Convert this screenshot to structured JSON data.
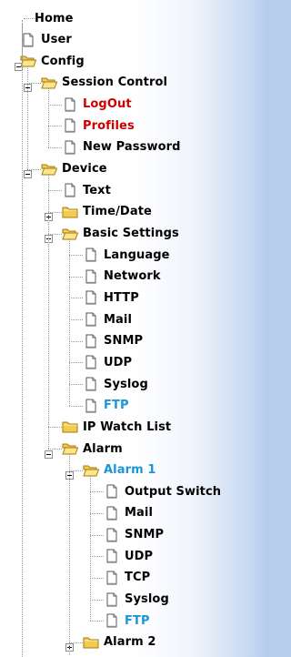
{
  "tree": [
    {
      "id": "home",
      "label": "Home",
      "depth": 0,
      "icon": "none",
      "toggle": "none",
      "color": "default"
    },
    {
      "id": "user",
      "label": "User",
      "depth": 1,
      "icon": "page-icon",
      "toggle": "none",
      "color": "default"
    },
    {
      "id": "config",
      "label": "Config",
      "depth": 1,
      "icon": "folder-open-icon",
      "toggle": "minus",
      "color": "default"
    },
    {
      "id": "session-control",
      "label": "Session Control",
      "depth": 2,
      "icon": "folder-open-icon",
      "toggle": "minus",
      "color": "default"
    },
    {
      "id": "logout",
      "label": "LogOut",
      "depth": 3,
      "icon": "page-icon",
      "toggle": "none",
      "color": "#cc0000"
    },
    {
      "id": "profiles",
      "label": "Profiles",
      "depth": 3,
      "icon": "page-icon",
      "toggle": "none",
      "color": "#cc0000"
    },
    {
      "id": "new-password",
      "label": "New Password",
      "depth": 3,
      "icon": "page-icon",
      "toggle": "none",
      "color": "default"
    },
    {
      "id": "device",
      "label": "Device",
      "depth": 2,
      "icon": "folder-open-icon",
      "toggle": "minus",
      "color": "default"
    },
    {
      "id": "text",
      "label": "Text",
      "depth": 3,
      "icon": "page-icon",
      "toggle": "none",
      "color": "default"
    },
    {
      "id": "time-date",
      "label": "Time/Date",
      "depth": 3,
      "icon": "folder-closed-icon",
      "toggle": "plus",
      "color": "default"
    },
    {
      "id": "basic-settings",
      "label": "Basic Settings",
      "depth": 3,
      "icon": "folder-open-icon",
      "toggle": "minus",
      "color": "default"
    },
    {
      "id": "language",
      "label": "Language",
      "depth": 4,
      "icon": "page-icon",
      "toggle": "none",
      "color": "default"
    },
    {
      "id": "network",
      "label": "Network",
      "depth": 4,
      "icon": "page-icon",
      "toggle": "none",
      "color": "default"
    },
    {
      "id": "http",
      "label": "HTTP",
      "depth": 4,
      "icon": "page-icon",
      "toggle": "none",
      "color": "default"
    },
    {
      "id": "mail",
      "label": "Mail",
      "depth": 4,
      "icon": "page-icon",
      "toggle": "none",
      "color": "default"
    },
    {
      "id": "snmp",
      "label": "SNMP",
      "depth": 4,
      "icon": "page-icon",
      "toggle": "none",
      "color": "default"
    },
    {
      "id": "udp",
      "label": "UDP",
      "depth": 4,
      "icon": "page-icon",
      "toggle": "none",
      "color": "default"
    },
    {
      "id": "syslog",
      "label": "Syslog",
      "depth": 4,
      "icon": "page-icon",
      "toggle": "none",
      "color": "default"
    },
    {
      "id": "ftp",
      "label": "FTP",
      "depth": 4,
      "icon": "page-icon",
      "toggle": "none",
      "color": "#1a95d9"
    },
    {
      "id": "ip-watch-list",
      "label": "IP Watch List",
      "depth": 3,
      "icon": "folder-closed-icon",
      "toggle": "none",
      "color": "default"
    },
    {
      "id": "alarm",
      "label": "Alarm",
      "depth": 3,
      "icon": "folder-open-icon",
      "toggle": "minus",
      "color": "default"
    },
    {
      "id": "alarm-1",
      "label": "Alarm 1",
      "depth": 4,
      "icon": "folder-open-icon",
      "toggle": "minus",
      "color": "#1a95d9"
    },
    {
      "id": "alarm1-output-switch",
      "label": "Output Switch",
      "depth": 5,
      "icon": "page-icon",
      "toggle": "none",
      "color": "default"
    },
    {
      "id": "alarm1-mail",
      "label": "Mail",
      "depth": 5,
      "icon": "page-icon",
      "toggle": "none",
      "color": "default"
    },
    {
      "id": "alarm1-snmp",
      "label": "SNMP",
      "depth": 5,
      "icon": "page-icon",
      "toggle": "none",
      "color": "default"
    },
    {
      "id": "alarm1-udp",
      "label": "UDP",
      "depth": 5,
      "icon": "page-icon",
      "toggle": "none",
      "color": "default"
    },
    {
      "id": "alarm1-tcp",
      "label": "TCP",
      "depth": 5,
      "icon": "page-icon",
      "toggle": "none",
      "color": "default"
    },
    {
      "id": "alarm1-syslog",
      "label": "Syslog",
      "depth": 5,
      "icon": "page-icon",
      "toggle": "none",
      "color": "default"
    },
    {
      "id": "alarm1-ftp",
      "label": "FTP",
      "depth": 5,
      "icon": "page-icon",
      "toggle": "none",
      "color": "#1a95d9"
    },
    {
      "id": "alarm-2",
      "label": "Alarm 2",
      "depth": 4,
      "icon": "folder-closed-icon",
      "toggle": "plus",
      "color": "default"
    }
  ]
}
